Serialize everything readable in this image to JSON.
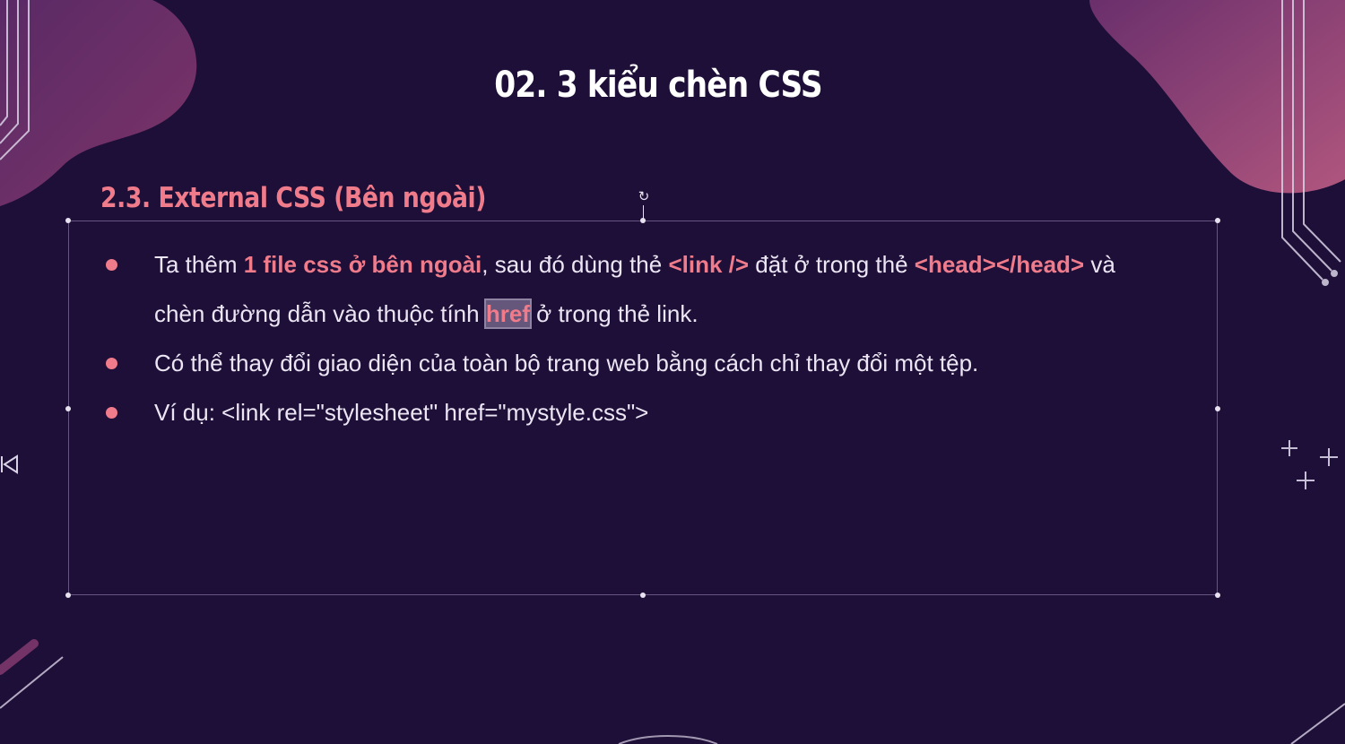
{
  "slide": {
    "title": "02. 3 kiểu chèn CSS",
    "section_heading": "2.3. External CSS (Bên ngoài)",
    "bullets": [
      {
        "line1": {
          "t1": "Ta thêm ",
          "h1": "1 file css ở bên ngoài",
          "t2": ", sau đó dùng thẻ ",
          "h2": "<link />",
          "t3": " đặt ở trong thẻ ",
          "h3": "<head></head>",
          "t4": " và"
        },
        "line2": {
          "t1": "chèn đường dẫn vào thuộc tính ",
          "h1": "href",
          "t2": " ở trong thẻ link."
        }
      },
      {
        "text": "Có thể thay đổi giao diện của toàn bộ trang web bằng cách chỉ thay đổi một tệp."
      },
      {
        "text": "Ví dụ: <link rel=\"stylesheet\" href=\"mystyle.css\">"
      }
    ]
  },
  "icons": {
    "rotate": "rotate-icon",
    "previous": "previous-slide-icon"
  },
  "colors": {
    "background": "#1e0f38",
    "accent": "#f07b8a",
    "text": "#ece6f4",
    "title": "#ffffff",
    "blob": "#8a3c72"
  }
}
